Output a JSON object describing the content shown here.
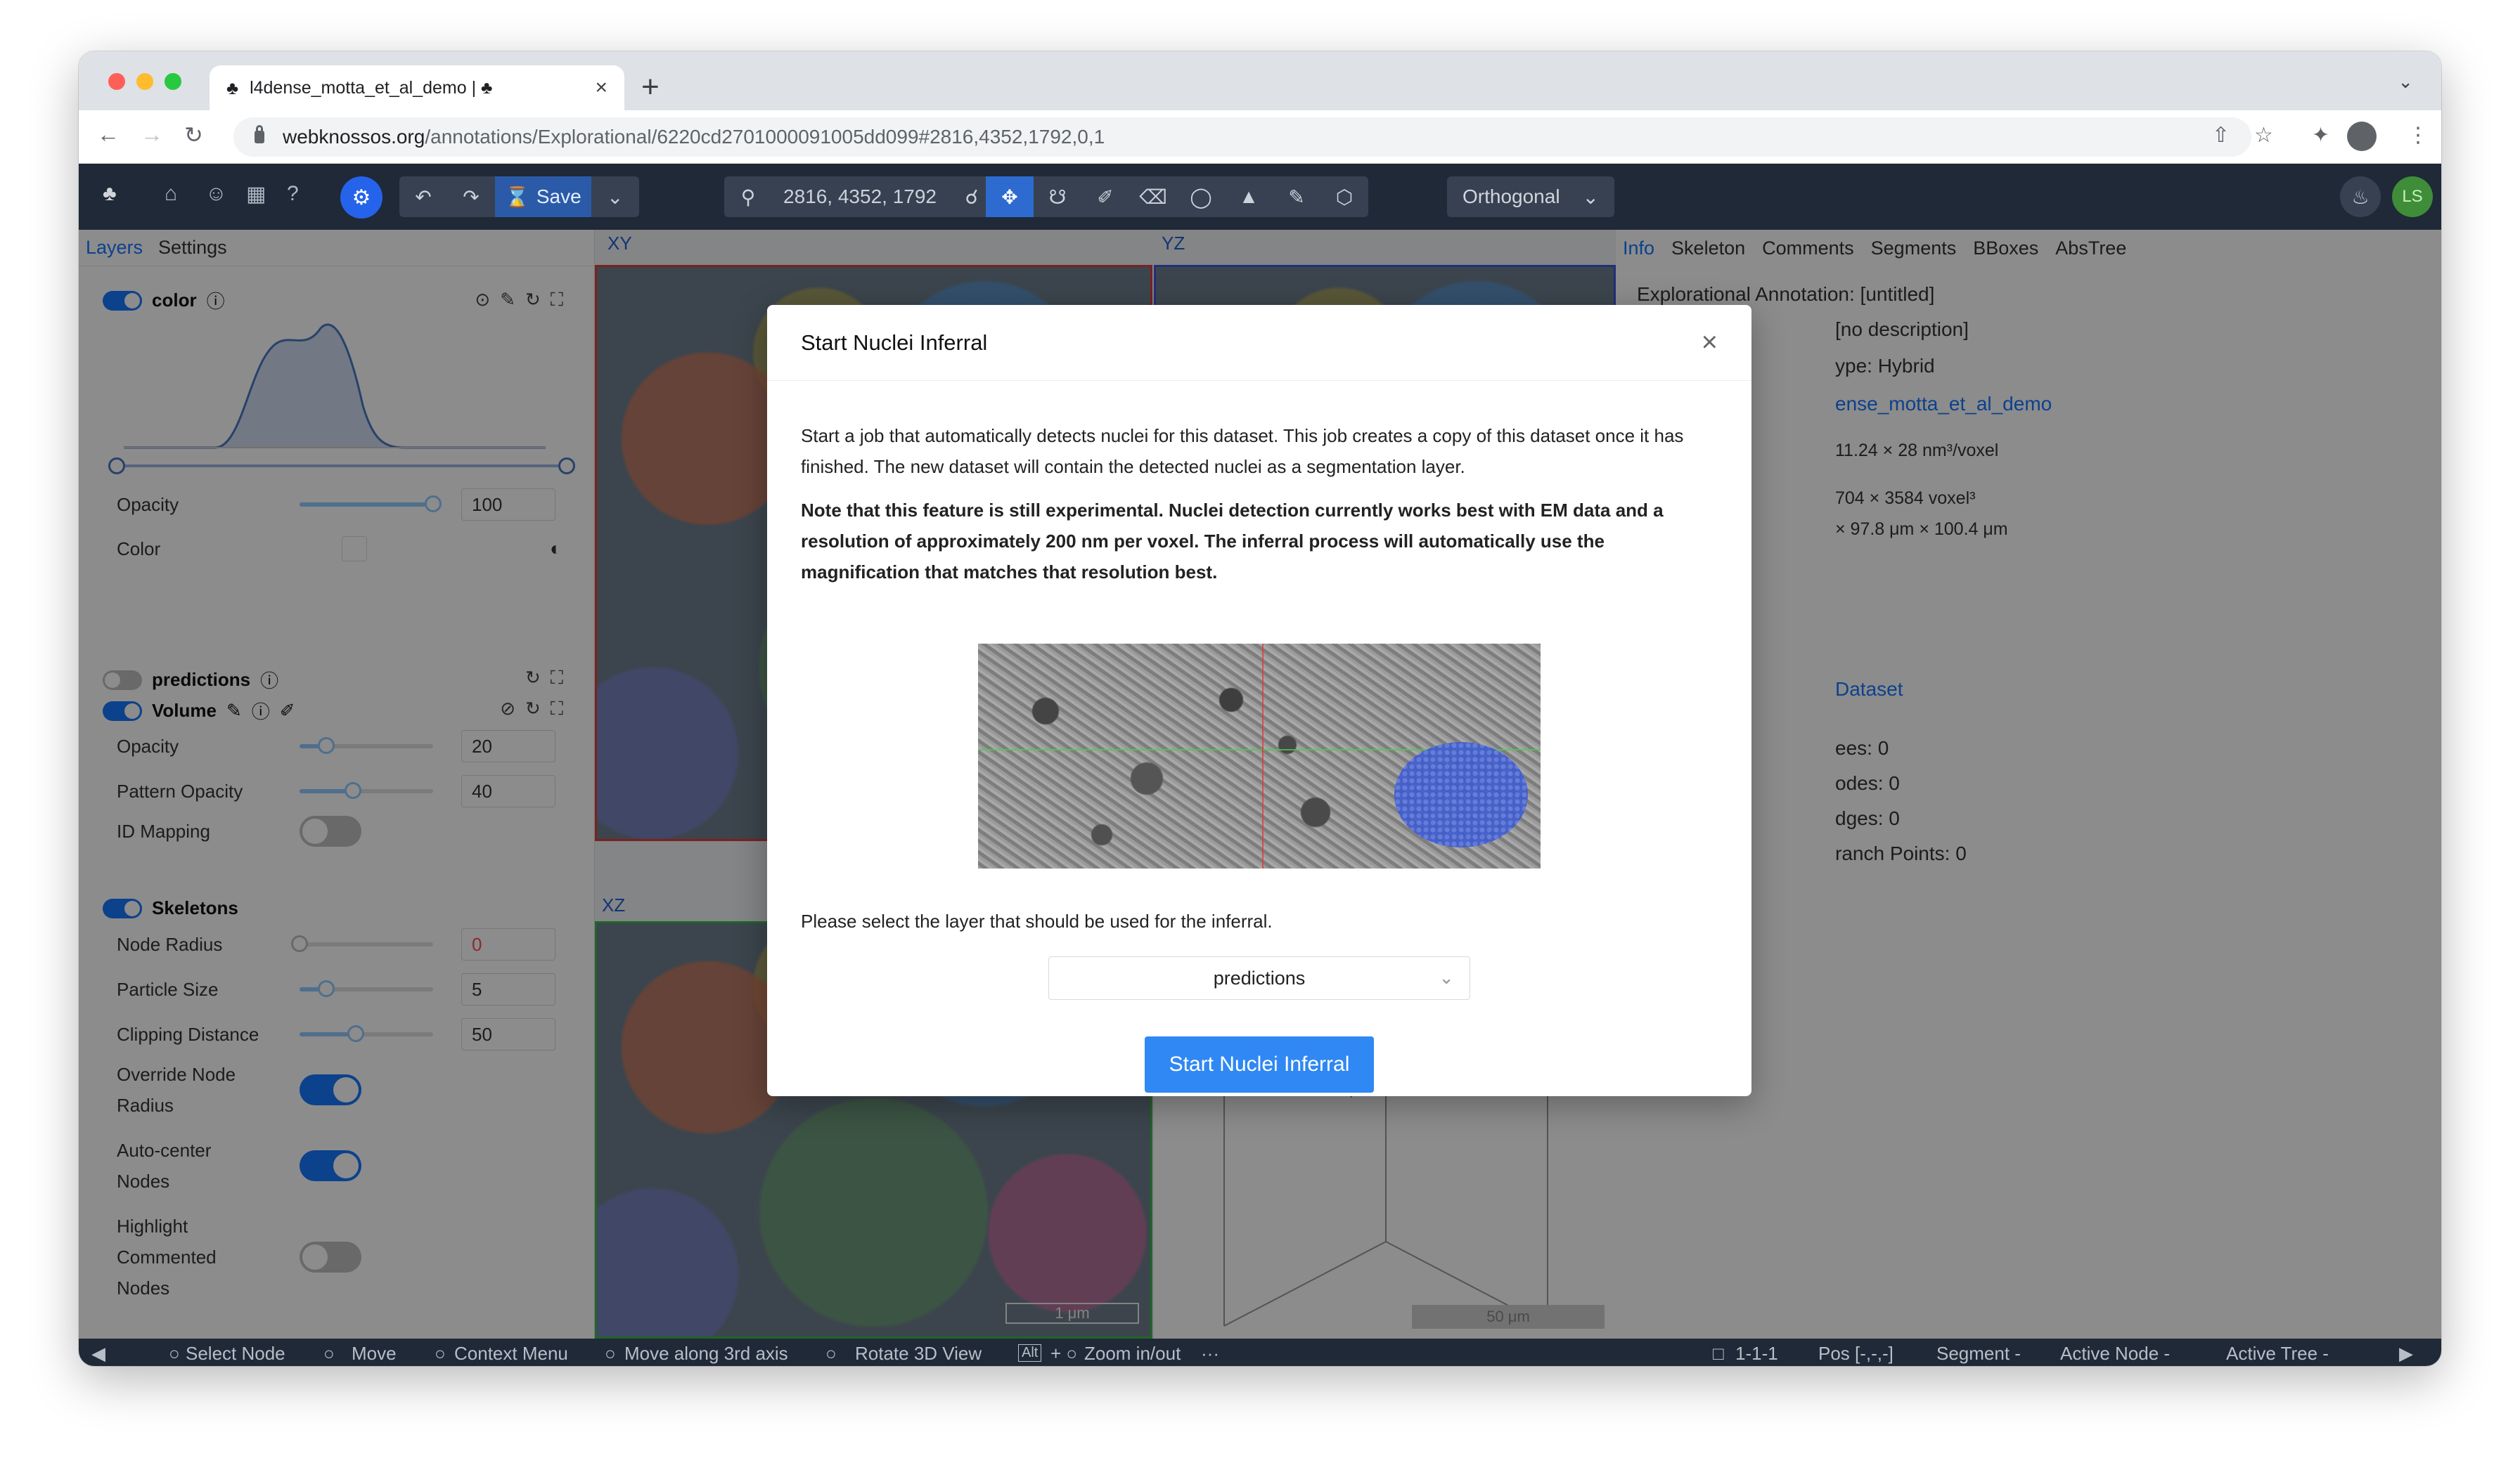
{
  "browser": {
    "tab_title": "l4dense_motta_et_al_demo | ♣",
    "url_host": "webknossos.org",
    "url_path": "/annotations/Explorational/6220cd2701000091005dd099#2816,4352,1792,0,1"
  },
  "toolbar": {
    "save_label": "Save",
    "coordinates": "2816, 4352, 1792",
    "view_mode": "Orthogonal",
    "avatar_initials": "LS"
  },
  "left_panel": {
    "tabs": [
      "Layers",
      "Settings"
    ],
    "color_layer": {
      "name": "color",
      "opacity_label": "Opacity",
      "opacity_value": "100",
      "opacity_fraction": 1.0,
      "color_label": "Color"
    },
    "predictions_layer": {
      "name": "predictions"
    },
    "volume_layer": {
      "name": "Volume",
      "opacity_label": "Opacity",
      "opacity_value": "20",
      "opacity_fraction": 0.2,
      "pattern_label": "Pattern Opacity",
      "pattern_value": "40",
      "pattern_fraction": 0.4,
      "id_mapping_label": "ID Mapping"
    },
    "skeletons": {
      "name": "Skeletons",
      "node_radius_label": "Node Radius",
      "node_radius_value": "0",
      "node_radius_fraction": 0.0,
      "particle_label": "Particle Size",
      "particle_value": "5",
      "particle_fraction": 0.2,
      "clipping_label": "Clipping Distance",
      "clipping_value": "50",
      "clipping_fraction": 0.42,
      "override_label_1": "Override Node",
      "override_label_2": "Radius",
      "autocenter_label_1": "Auto-center",
      "autocenter_label_2": "Nodes",
      "highlight_label_1": "Highlight",
      "highlight_label_2": "Commented",
      "highlight_label_3": "Nodes"
    }
  },
  "viewports": {
    "xy": "XY",
    "yz": "YZ",
    "xz": "XZ",
    "scale_xz": "1 μm",
    "scale_3d": "50 μm"
  },
  "right_panel": {
    "tabs": [
      "Info",
      "Skeleton",
      "Comments",
      "Segments",
      "BBoxes",
      "AbsTree"
    ],
    "annotation_title": "Explorational Annotation:  [untitled]",
    "description": "[no description]",
    "type": "ype: Hybrid",
    "dataset_link": "ense_motta_et_al_demo",
    "voxel_size": "11.24 × 28 nm³/voxel",
    "extent_voxel": "704 × 3584 voxel³",
    "extent_um": "× 97.8 μm × 100.4 μm",
    "dataset_short": "Dataset",
    "trees": "ees: 0",
    "nodes": "odes: 0",
    "edges": "dges: 0",
    "branch_points": "ranch Points: 0"
  },
  "statusbar": {
    "select_node": "Select Node",
    "move": "Move",
    "context_menu": "Context Menu",
    "move_3rd": "Move along 3rd axis",
    "rotate_3d": "Rotate 3D View",
    "zoom": "Zoom in/out",
    "alt_key": "Alt",
    "ellipsis": "···",
    "mag": "1-1-1",
    "pos": "Pos [-,-,-]",
    "segment": "Segment -",
    "active_node": "Active Node -",
    "active_tree": "Active Tree -"
  },
  "modal": {
    "title": "Start Nuclei Inferral",
    "paragraph": "Start a job that automatically detects nuclei for this dataset. This job creates a copy of this dataset once it has finished. The new dataset will contain the detected nuclei as a segmentation layer.",
    "note": "Note that this feature is still experimental. Nuclei detection currently works best with EM data and a resolution of approximately 200 nm per voxel. The inferral process will automatically use the magnification that matches that resolution best.",
    "select_prompt": "Please select the layer that should be used for the inferral.",
    "selected_layer": "predictions",
    "start_button": "Start Nuclei Inferral"
  },
  "colors": {
    "accent": "#1677ff",
    "primary_button": "#2f88f3",
    "app_toolbar": "#1f2937",
    "nucleus_overlay": "#3f5bd0"
  }
}
